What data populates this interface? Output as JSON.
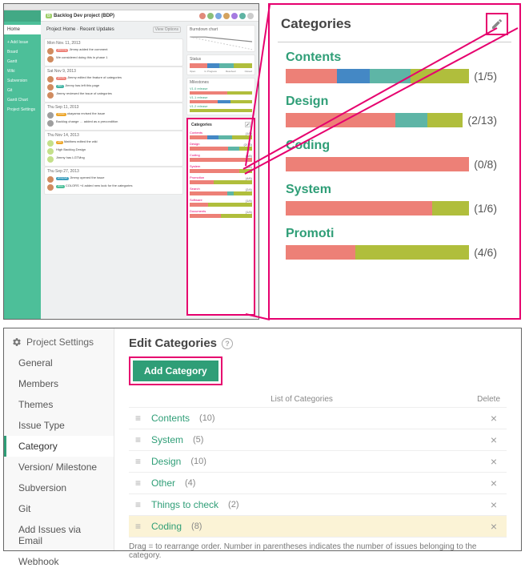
{
  "panel_a": {
    "project_title_tag": "B",
    "project_title": "Backlog Dev project (BDP)",
    "breadcrumb": "Project Home · Recent Updates",
    "sidebar": {
      "home": "Home",
      "items": [
        {
          "label": "+ Add Issue"
        },
        {
          "label": "Board"
        },
        {
          "label": "Gantt"
        },
        {
          "label": "Wiki"
        },
        {
          "label": "Subversion"
        },
        {
          "label": "Git"
        },
        {
          "label": "Gantt Chart"
        },
        {
          "label": "Project Settings"
        }
      ]
    },
    "view_options": "View Options",
    "updates": [
      {
        "day": "Mon Nov. 11, 2013",
        "items": [
          {
            "user_color": "#d08b5f",
            "chip": "pink",
            "chip_text": "planning",
            "text": "Jimmy added the comment"
          },
          {
            "user_color": "#d08b5f",
            "text": "We considered doing this in phase 1"
          }
        ]
      },
      {
        "day": "Sat Nov 9, 2013",
        "items": [
          {
            "user_color": "#d08b5f",
            "chip": "pink",
            "chip_text": "priority",
            "text": "Jimmy edited the feature of categories"
          },
          {
            "user_color": "#d08b5f",
            "chip": "teal",
            "chip_text": "DEV",
            "text": "Jimmy has left this page"
          },
          {
            "user_color": "#d08b5f",
            "text": "Jimmy reviewed the issue of categories"
          }
        ]
      },
      {
        "day": "Thu Sep 11, 2013",
        "items": [
          {
            "user_color": "#9e9e9e",
            "chip": "orange",
            "chip_text": "review",
            "text": "okayama revised the issue"
          },
          {
            "user_color": "#9e9e9e",
            "text": "Backlog change … added as a precondition"
          }
        ]
      },
      {
        "day": "Thu Nov 14, 2013",
        "items": [
          {
            "user_color": "#c4e08a",
            "chip": "orange",
            "chip_text": "edit",
            "text": "Matthew edited the wiki"
          },
          {
            "user_color": "#c4e08a",
            "text": "High Backlog Design"
          },
          {
            "user_color": "#c4e08a",
            "text": "Jimmy has LGTMng"
          }
        ]
      },
      {
        "day": "Thu Sep 27, 2013",
        "items": [
          {
            "user_color": "#d08b5f",
            "chip": "blue",
            "chip_text": "accepted",
            "text": "Jimmy opened the issue"
          },
          {
            "user_color": "#d08b5f",
            "chip": "green",
            "chip_text": "done",
            "text": "COLORS +4 added new look for the categories"
          }
        ]
      }
    ],
    "burndown_title": "Burndown chart",
    "status_title": "Status",
    "status_labels": [
      "Open",
      "In Progress",
      "Resolved",
      "Closed"
    ],
    "milestones_title": "Milestones",
    "mini_cat_title": "Categories",
    "mini_cats": [
      {
        "label": "Contents",
        "count": "(1/5)"
      },
      {
        "label": "Design",
        "count": "(2/13)"
      },
      {
        "label": "Coding",
        "count": "(0/8)"
      },
      {
        "label": "System",
        "count": "(1/6)"
      },
      {
        "label": "Promotion",
        "count": "(4/6)"
      },
      {
        "label": "Search",
        "count": "(2/4)"
      },
      {
        "label": "Software",
        "count": "(1/4)"
      },
      {
        "label": "Documents",
        "count": "(1/4)"
      }
    ]
  },
  "panel_b": {
    "title": "Categories",
    "cats": [
      {
        "name": "Contents",
        "count": "(1/5)",
        "segs": [
          28,
          18,
          22,
          32
        ]
      },
      {
        "name": "Design",
        "count": "(2/13)",
        "segs": [
          62,
          0,
          18,
          20
        ]
      },
      {
        "name": "Coding",
        "count": "(0/8)",
        "segs": [
          100,
          0,
          0,
          0
        ]
      },
      {
        "name": "System",
        "count": "(1/6)",
        "segs": [
          80,
          0,
          0,
          20
        ]
      },
      {
        "name": "Promoti",
        "count": "(4/6)",
        "segs": [
          38,
          0,
          0,
          62
        ]
      }
    ]
  },
  "panel_c": {
    "nav_title": "Project Settings",
    "nav": [
      {
        "label": "General"
      },
      {
        "label": "Members"
      },
      {
        "label": "Themes"
      },
      {
        "label": "Issue Type"
      },
      {
        "label": "Category",
        "active": true
      },
      {
        "label": "Version/ Milestone"
      },
      {
        "label": "Subversion"
      },
      {
        "label": "Git"
      },
      {
        "label": "Add Issues via Email"
      },
      {
        "label": "Webhook"
      }
    ],
    "edit_title": "Edit Categories",
    "add_btn": "Add Category",
    "list_header": "List of Categories",
    "delete_header": "Delete",
    "rows": [
      {
        "name": "Contents",
        "count": "(10)"
      },
      {
        "name": "System",
        "count": "(5)"
      },
      {
        "name": "Design",
        "count": "(10)"
      },
      {
        "name": "Other",
        "count": "(4)"
      },
      {
        "name": "Things to check",
        "count": "(2)"
      },
      {
        "name": "Coding",
        "count": "(8)",
        "hl": true
      }
    ],
    "hint_pre": "Drag",
    "hint_post": "to rearrange order. Number in parentheses indicates the number of issues belonging to the category."
  }
}
